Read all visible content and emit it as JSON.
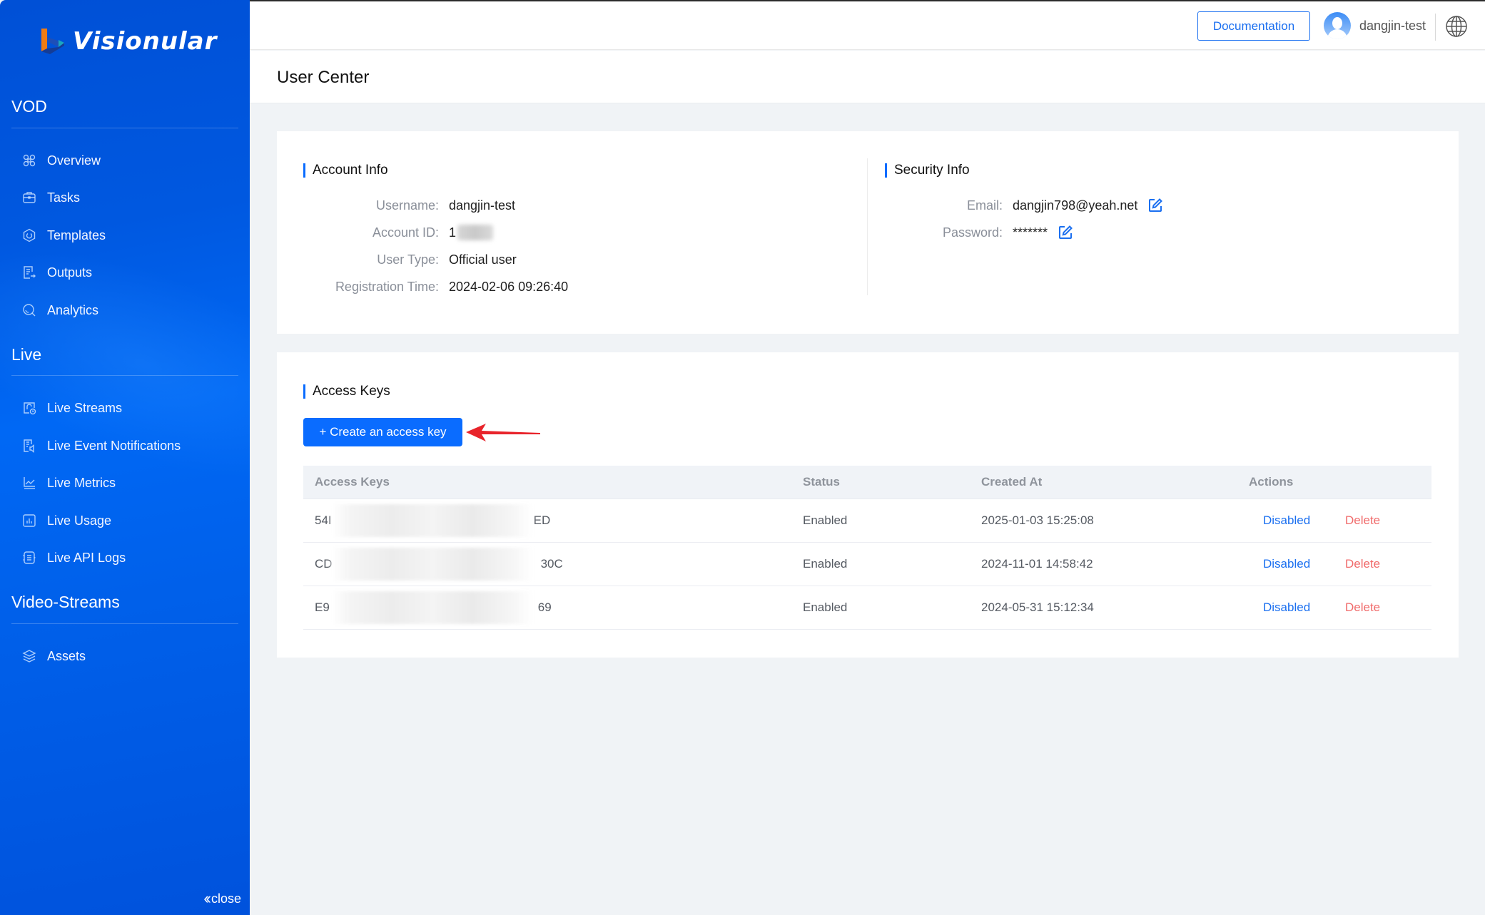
{
  "sidebar": {
    "brand": "Visionular",
    "sections": [
      {
        "title": "VOD",
        "items": [
          {
            "label": "Overview",
            "icon": "command-icon"
          },
          {
            "label": "Tasks",
            "icon": "briefcase-icon"
          },
          {
            "label": "Templates",
            "icon": "hexagon-icon"
          },
          {
            "label": "Outputs",
            "icon": "document-export-icon"
          },
          {
            "label": "Analytics",
            "icon": "search-analytics-icon"
          }
        ]
      },
      {
        "title": "Live",
        "items": [
          {
            "label": "Live Streams",
            "icon": "stream-clock-icon"
          },
          {
            "label": "Live Event Notifications",
            "icon": "notification-doc-icon"
          },
          {
            "label": "Live Metrics",
            "icon": "line-chart-icon"
          },
          {
            "label": "Live Usage",
            "icon": "bar-chart-icon"
          },
          {
            "label": "Live API Logs",
            "icon": "log-list-icon"
          }
        ]
      },
      {
        "title": "Video-Streams",
        "items": [
          {
            "label": "Assets",
            "icon": "layers-icon"
          }
        ]
      }
    ],
    "close_label": "close"
  },
  "header": {
    "documentation_label": "Documentation",
    "username": "dangjin-test"
  },
  "page": {
    "title": "User Center"
  },
  "account_info": {
    "heading": "Account Info",
    "fields": [
      {
        "label": "Username:",
        "value": "dangjin-test"
      },
      {
        "label": "Account ID:",
        "value": "1"
      },
      {
        "label": "User Type:",
        "value": "Official user"
      },
      {
        "label": "Registration Time:",
        "value": "2024-02-06 09:26:40"
      }
    ]
  },
  "security_info": {
    "heading": "Security Info",
    "fields": [
      {
        "label": "Email:",
        "value": "dangjin798@yeah.net"
      },
      {
        "label": "Password:",
        "value": "*******"
      }
    ]
  },
  "access_keys": {
    "heading": "Access Keys",
    "create_label": "+ Create an access key",
    "columns": [
      "Access Keys",
      "Status",
      "Created At",
      "Actions"
    ],
    "rows": [
      {
        "key_start": "54I",
        "key_end": "ED",
        "status": "Enabled",
        "created_at": "2025-01-03 15:25:08",
        "action_toggle": "Disabled",
        "action_delete": "Delete"
      },
      {
        "key_start": "CD",
        "key_end": "30C",
        "status": "Enabled",
        "created_at": "2024-11-01 14:58:42",
        "action_toggle": "Disabled",
        "action_delete": "Delete"
      },
      {
        "key_start": "E9",
        "key_end": "69",
        "status": "Enabled",
        "created_at": "2024-05-31 15:12:34",
        "action_toggle": "Disabled",
        "action_delete": "Delete"
      }
    ]
  },
  "colors": {
    "accent": "#0a6cff",
    "danger": "#f06a6a",
    "sidebar": "#0058e0",
    "annotation_arrow": "#e8242b"
  }
}
